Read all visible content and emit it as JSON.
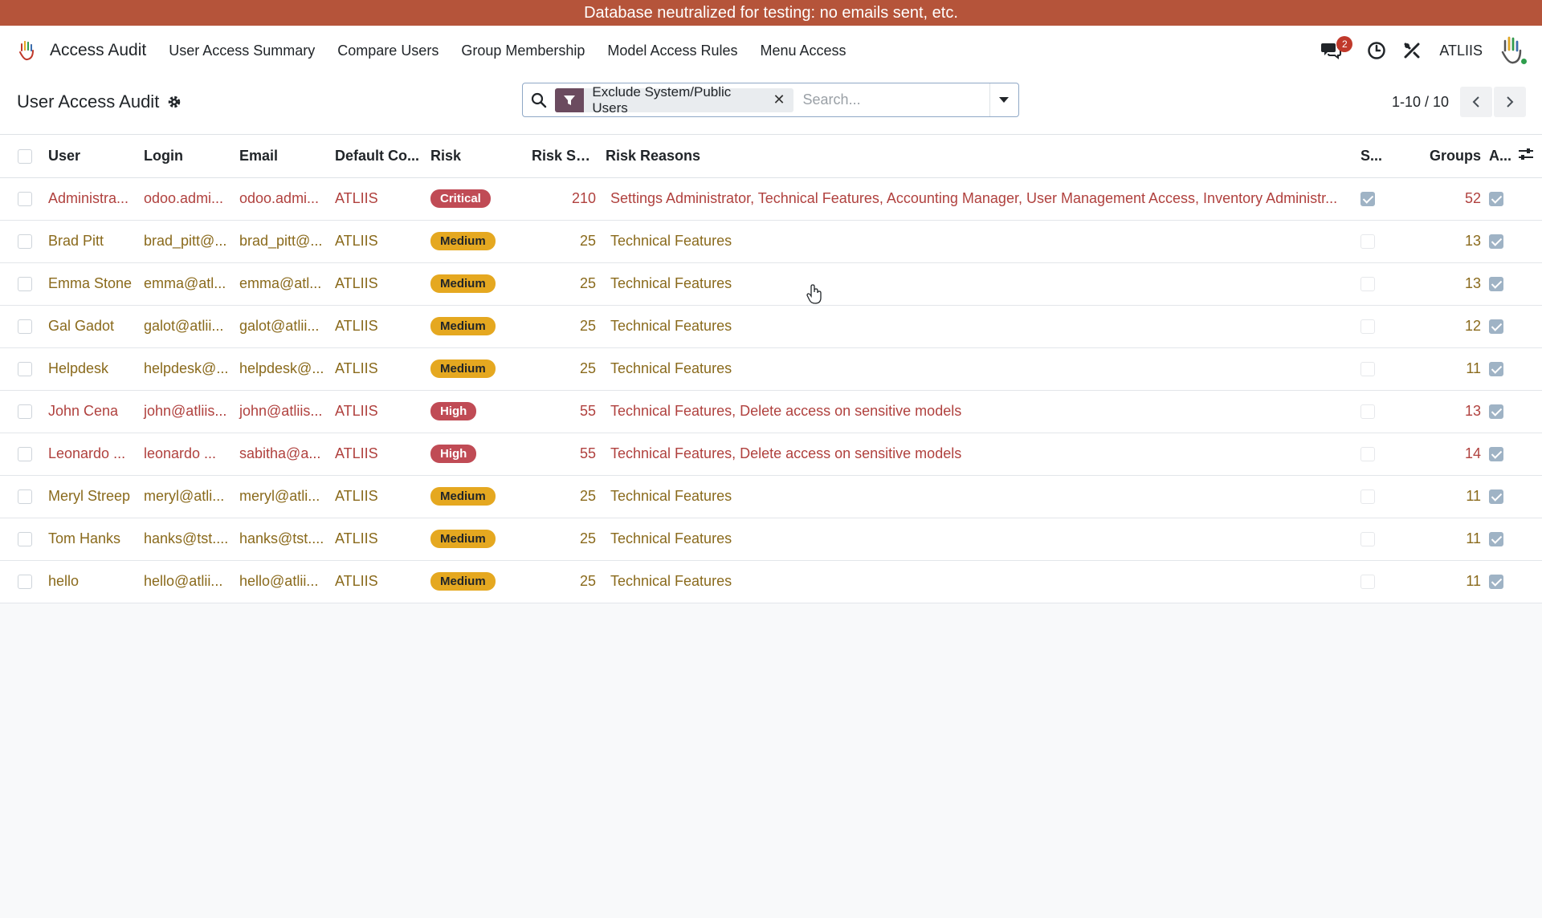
{
  "banner": {
    "text": "Database neutralized for testing: no emails sent, etc."
  },
  "navbar": {
    "app_name": "Access Audit",
    "menu": [
      "User Access Summary",
      "Compare Users",
      "Group Membership",
      "Model Access Rules",
      "Menu Access"
    ],
    "chat_count": "2",
    "company": "ATLIIS"
  },
  "control": {
    "title": "User Access Audit",
    "facet": "Exclude System/Public Users",
    "search_placeholder": "Search...",
    "pager": "1-10 / 10"
  },
  "table": {
    "columns": {
      "user": "User",
      "login": "Login",
      "email": "Email",
      "company": "Default Co...",
      "risk": "Risk",
      "risk_score": "Risk Score",
      "risk_reasons": "Risk Reasons",
      "s": "S...",
      "groups": "Groups",
      "a": "A..."
    },
    "rows": [
      {
        "user": "Administra...",
        "login": "odoo.admi...",
        "email": "odoo.admi...",
        "company": "ATLIIS",
        "risk": "Critical",
        "score": "210",
        "reasons": "Settings Administrator, Technical Features, Accounting Manager, User Management Access, Inventory Administr...",
        "s": true,
        "groups": "52",
        "a": true
      },
      {
        "user": "Brad Pitt",
        "login": "brad_pitt@...",
        "email": "brad_pitt@...",
        "company": "ATLIIS",
        "risk": "Medium",
        "score": "25",
        "reasons": "Technical Features",
        "s": false,
        "groups": "13",
        "a": true
      },
      {
        "user": "Emma Stone",
        "login": "emma@atl...",
        "email": "emma@atl...",
        "company": "ATLIIS",
        "risk": "Medium",
        "score": "25",
        "reasons": "Technical Features",
        "s": false,
        "groups": "13",
        "a": true
      },
      {
        "user": "Gal Gadot",
        "login": "galot@atlii...",
        "email": "galot@atlii...",
        "company": "ATLIIS",
        "risk": "Medium",
        "score": "25",
        "reasons": "Technical Features",
        "s": false,
        "groups": "12",
        "a": true
      },
      {
        "user": "Helpdesk",
        "login": "helpdesk@...",
        "email": "helpdesk@...",
        "company": "ATLIIS",
        "risk": "Medium",
        "score": "25",
        "reasons": "Technical Features",
        "s": false,
        "groups": "11",
        "a": true
      },
      {
        "user": "John Cena",
        "login": "john@atliis...",
        "email": "john@atliis...",
        "company": "ATLIIS",
        "risk": "High",
        "score": "55",
        "reasons": "Technical Features, Delete access on sensitive models",
        "s": false,
        "groups": "13",
        "a": true
      },
      {
        "user": "Leonardo ...",
        "login": "leonardo ...",
        "email": "sabitha@a...",
        "company": "ATLIIS",
        "risk": "High",
        "score": "55",
        "reasons": "Technical Features, Delete access on sensitive models",
        "s": false,
        "groups": "14",
        "a": true
      },
      {
        "user": "Meryl Streep",
        "login": "meryl@atli...",
        "email": "meryl@atli...",
        "company": "ATLIIS",
        "risk": "Medium",
        "score": "25",
        "reasons": "Technical Features",
        "s": false,
        "groups": "11",
        "a": true
      },
      {
        "user": "Tom Hanks",
        "login": "hanks@tst....",
        "email": "hanks@tst....",
        "company": "ATLIIS",
        "risk": "Medium",
        "score": "25",
        "reasons": "Technical Features",
        "s": false,
        "groups": "11",
        "a": true
      },
      {
        "user": "hello",
        "login": "hello@atlii...",
        "email": "hello@atlii...",
        "company": "ATLIIS",
        "risk": "Medium",
        "score": "25",
        "reasons": "Technical Features",
        "s": false,
        "groups": "11",
        "a": true
      }
    ]
  },
  "colors": {
    "banner": "#b5543a",
    "critical": "#c04b55",
    "medium": "#e5a820",
    "link": "#8a6a1c",
    "filter_facet": "#6b4b5f"
  }
}
